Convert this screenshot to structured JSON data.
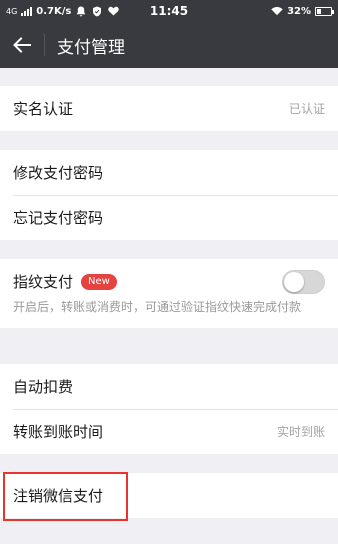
{
  "status_bar": {
    "network": "4G",
    "speed": "0.7K/s",
    "time": "11:45",
    "battery_percent": "32%",
    "battery_level": 0.32
  },
  "header": {
    "title": "支付管理",
    "back_icon": "arrow-left-icon"
  },
  "sections": {
    "identity": {
      "label": "实名认证",
      "value": "已认证"
    },
    "password": {
      "change_label": "修改支付密码",
      "forgot_label": "忘记支付密码"
    },
    "fingerprint": {
      "label": "指纹支付",
      "badge": "New",
      "toggle_on": false,
      "description": "开启后，转账或消费时，可通过验证指纹快速完成付款"
    },
    "deduction": {
      "auto_label": "自动扣费",
      "transfer_label": "转账到账时间",
      "transfer_value": "实时到账"
    },
    "cancel": {
      "label": "注销微信支付"
    }
  },
  "colors": {
    "header_bg": "#393a3f",
    "page_bg": "#efeff4",
    "badge": "#e64340",
    "highlight": "#e8332e"
  }
}
